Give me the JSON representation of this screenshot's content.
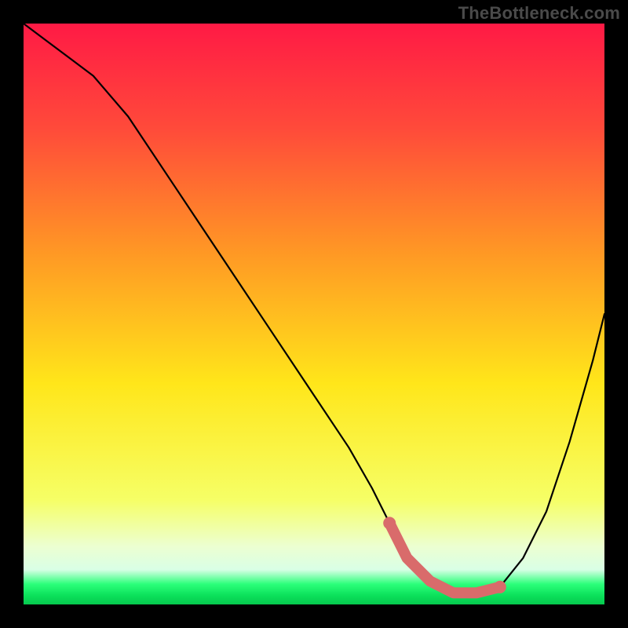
{
  "watermark": "TheBottleneck.com",
  "chart_data": {
    "type": "line",
    "title": "",
    "xlabel": "",
    "ylabel": "",
    "xlim": [
      0,
      100
    ],
    "ylim": [
      0,
      100
    ],
    "series": [
      {
        "name": "curve",
        "x": [
          0,
          4,
          8,
          12,
          18,
          26,
          34,
          42,
          50,
          56,
          60,
          63,
          66,
          70,
          74,
          78,
          82,
          86,
          90,
          94,
          98,
          100
        ],
        "y": [
          100,
          97,
          94,
          91,
          84,
          72,
          60,
          48,
          36,
          27,
          20,
          14,
          8,
          4,
          2,
          2,
          3,
          8,
          16,
          28,
          42,
          50
        ]
      }
    ],
    "flat_segment": {
      "x_start": 63,
      "x_end": 82,
      "color": "#d96b6b"
    },
    "background_gradient": {
      "stops": [
        {
          "offset": 0.0,
          "color": "#ff1a45"
        },
        {
          "offset": 0.18,
          "color": "#ff4a3a"
        },
        {
          "offset": 0.4,
          "color": "#ff9a24"
        },
        {
          "offset": 0.62,
          "color": "#ffe61a"
        },
        {
          "offset": 0.82,
          "color": "#f6ff66"
        },
        {
          "offset": 0.9,
          "color": "#ecffd1"
        },
        {
          "offset": 0.94,
          "color": "#d9ffe6"
        },
        {
          "offset": 0.965,
          "color": "#2bff7a"
        },
        {
          "offset": 0.985,
          "color": "#0be05a"
        },
        {
          "offset": 1.0,
          "color": "#06c94e"
        }
      ]
    }
  }
}
